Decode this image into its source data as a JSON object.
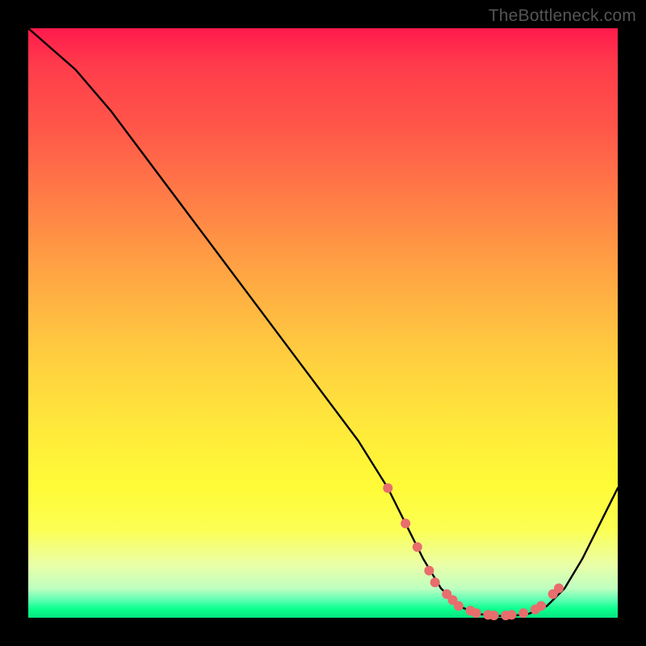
{
  "watermark": "TheBottleneck.com",
  "chart_data": {
    "type": "line",
    "title": "",
    "xlabel": "",
    "ylabel": "",
    "xlim": [
      0,
      100
    ],
    "ylim": [
      0,
      100
    ],
    "series": [
      {
        "name": "curve",
        "x": [
          0,
          8,
          14,
          20,
          26,
          32,
          38,
          44,
          50,
          56,
          61,
          64,
          67,
          70,
          73,
          76,
          79,
          82,
          85,
          88,
          91,
          94,
          97,
          100
        ],
        "values": [
          100,
          93,
          86,
          78,
          70,
          62,
          54,
          46,
          38,
          30,
          22,
          16,
          10,
          5,
          2,
          0.7,
          0.3,
          0.3,
          0.7,
          2,
          5,
          10,
          16,
          22
        ]
      }
    ],
    "markers": {
      "name": "points",
      "x": [
        61,
        64,
        66,
        68,
        69,
        71,
        72,
        73,
        75,
        76,
        78,
        79,
        81,
        82,
        84,
        86,
        87,
        89,
        90
      ],
      "values": [
        22,
        16,
        12,
        8,
        6,
        4,
        3,
        2,
        1.2,
        0.8,
        0.5,
        0.4,
        0.4,
        0.5,
        0.8,
        1.4,
        2,
        4,
        5
      ]
    },
    "colors": {
      "curve": "#000000",
      "marker": "#e86d6d"
    }
  }
}
